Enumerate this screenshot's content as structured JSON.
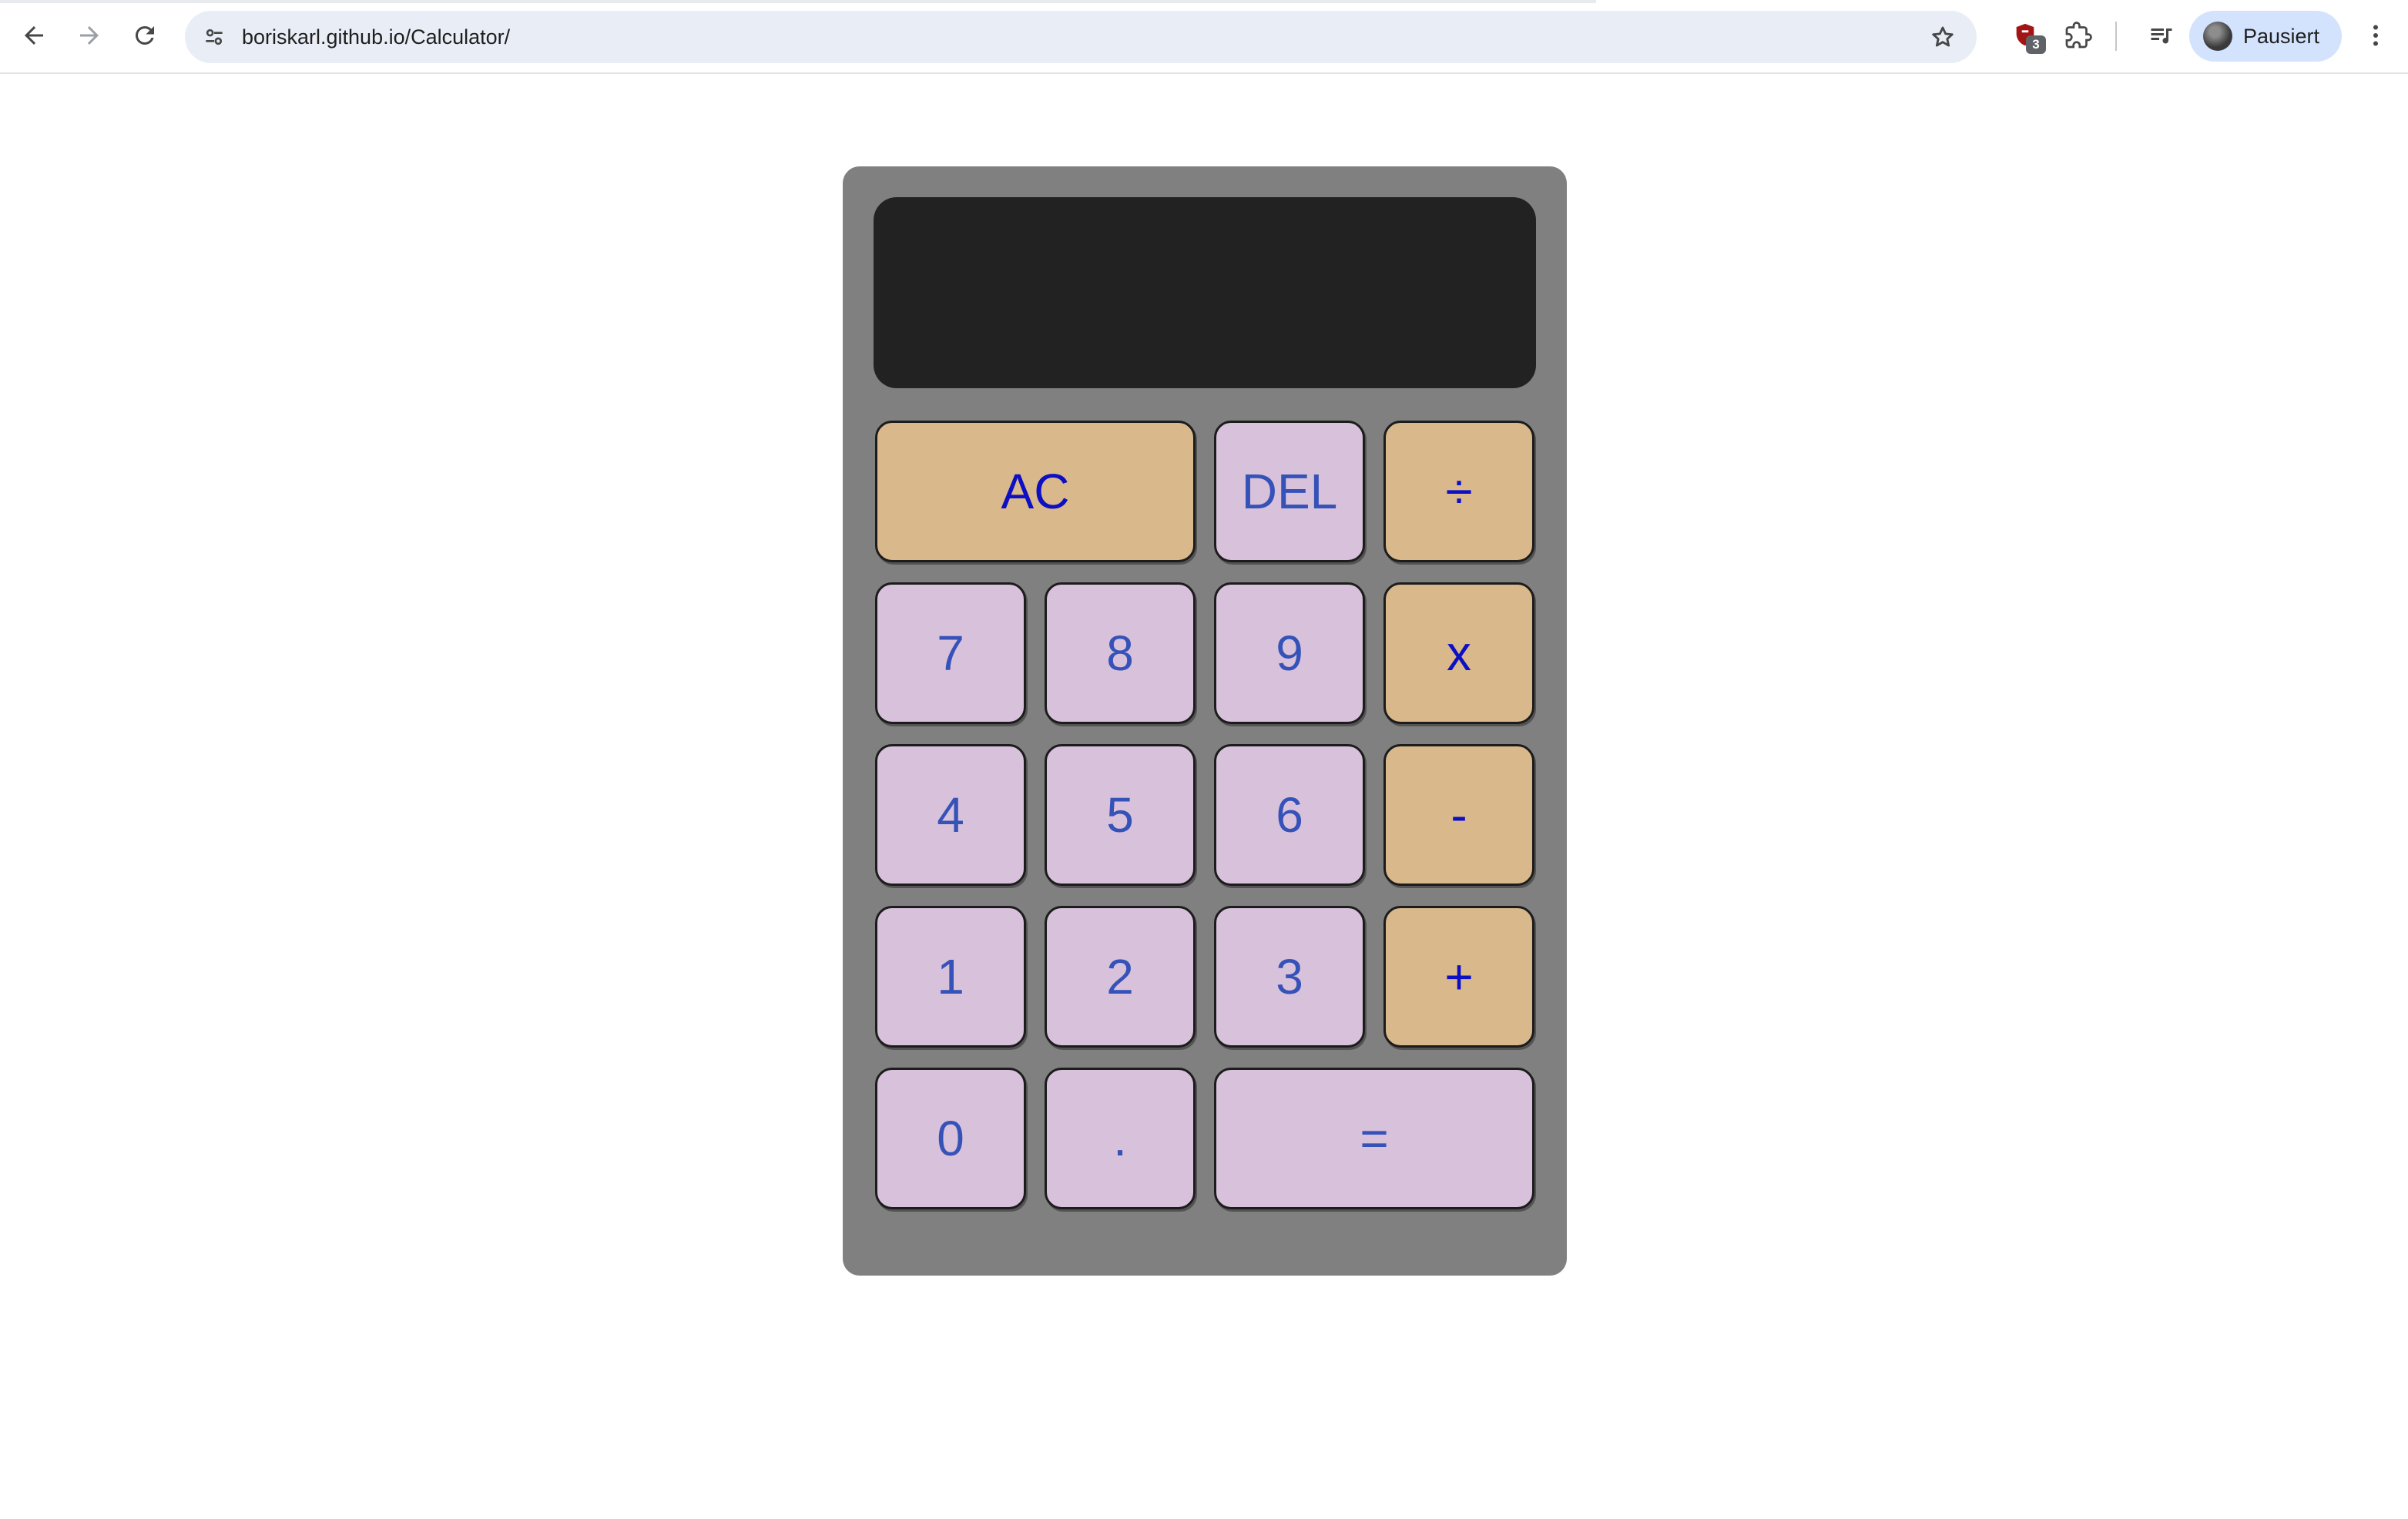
{
  "browser": {
    "url": "boriskarl.github.io/Calculator/",
    "extension_badge_count": "3",
    "profile_label": "Pausiert",
    "icons": {
      "back": "arrow-left-icon",
      "forward": "arrow-right-icon",
      "reload": "reload-icon",
      "site_info": "tune-icon",
      "bookmark": "star-icon",
      "extension": "shield-extension-icon",
      "extensions_menu": "puzzle-icon",
      "media": "media-queue-icon",
      "menu": "kebab-menu-icon"
    }
  },
  "calculator": {
    "display_value": "",
    "colors": {
      "body": "#808080",
      "display": "#222222",
      "number_key": "#d8c1db",
      "number_text": "#3552b8",
      "operator_key": "#d9b88b",
      "operator_text": "#0d0fc4"
    },
    "keys": {
      "ac": "AC",
      "del": "DEL",
      "divide": "÷",
      "seven": "7",
      "eight": "8",
      "nine": "9",
      "multiply": "x",
      "four": "4",
      "five": "5",
      "six": "6",
      "subtract": "-",
      "one": "1",
      "two": "2",
      "three": "3",
      "add": "+",
      "zero": "0",
      "decimal": ".",
      "equals": "="
    }
  }
}
